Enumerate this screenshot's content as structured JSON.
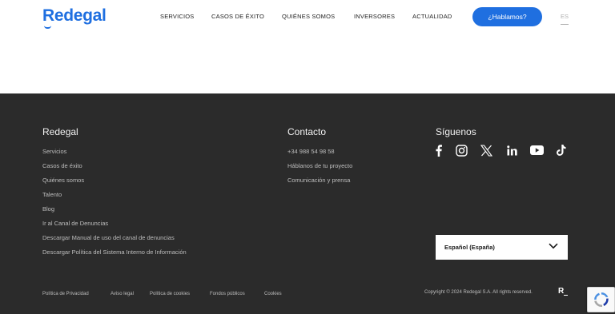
{
  "header": {
    "logo": "Redegal",
    "nav": [
      "SERVICIOS",
      "CASOS DE ÉXITO",
      "QUIÉNES SOMOS",
      "INVERSORES",
      "ACTUALIDAD"
    ],
    "cta_label": "¿Hablamos?",
    "language": "ES"
  },
  "footer": {
    "redegal": {
      "title": "Redegal",
      "links": [
        "Servicios",
        "Casos de éxito",
        "Quiénes somos",
        "Talento",
        "Blog",
        "Ir al Canal de Denuncias",
        "Descargar Manual de uso del canal de denuncias",
        "Descargar Política del Sistema Interno de Información"
      ]
    },
    "contacto": {
      "title": "Contacto",
      "links": [
        "+34 988 54 98 58",
        "Háblanos de tu proyecto",
        "Comunicación y prensa"
      ]
    },
    "siguenos": {
      "title": "Síguenos",
      "icons": [
        "facebook-icon",
        "instagram-icon",
        "x-icon",
        "linkedin-icon",
        "youtube-icon",
        "tiktok-icon"
      ]
    },
    "language_select": "Español (España)",
    "bottom_links": [
      "Política de Privacidad",
      "Aviso legal",
      "Política de cookies",
      "Fondos públicos",
      "Cookies"
    ],
    "copyright": "Copyright © 2024 Redegal S.A. All rights reserved.",
    "mark": "R"
  },
  "colors": {
    "brand": "#1f6fe0",
    "footer_bg": "#2b2b2b",
    "footer_text": "#bdbdbd"
  }
}
